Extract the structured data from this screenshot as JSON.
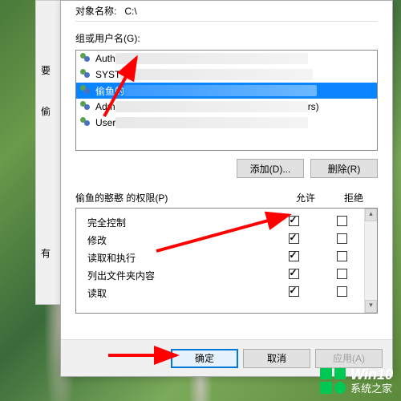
{
  "bg": {
    "label1": "要",
    "label2": "偷",
    "label3": "有"
  },
  "top": {
    "obj_label": "对象名称:",
    "obj_value": "C:\\"
  },
  "groups_label": "组或用户名(G):",
  "users": [
    {
      "prefix": "Auth",
      "kind": "light"
    },
    {
      "prefix": "SYST",
      "kind": "light"
    },
    {
      "prefix": "偷鱼的",
      "kind": "blue",
      "selected": true
    },
    {
      "prefix": "Adm",
      "kind": "light",
      "suffix_paren": true,
      "tail": "rs)"
    },
    {
      "prefix": "User",
      "kind": "light"
    }
  ],
  "buttons": {
    "add": "添加(D)...",
    "remove": "删除(R)",
    "ok": "确定",
    "cancel": "取消",
    "apply": "应用(A)"
  },
  "perm_label_prefix": "偷鱼的憨憨 的权限(P)",
  "perm_cols": {
    "allow": "允许",
    "deny": "拒绝"
  },
  "perms": [
    {
      "name": "完全控制",
      "allow": true,
      "deny": false
    },
    {
      "name": "修改",
      "allow": true,
      "deny": false
    },
    {
      "name": "读取和执行",
      "allow": true,
      "deny": false
    },
    {
      "name": "列出文件夹内容",
      "allow": true,
      "deny": false
    },
    {
      "name": "读取",
      "allow": true,
      "deny": false
    }
  ],
  "watermark": {
    "line1": "Win10",
    "line2": "系统之家"
  }
}
